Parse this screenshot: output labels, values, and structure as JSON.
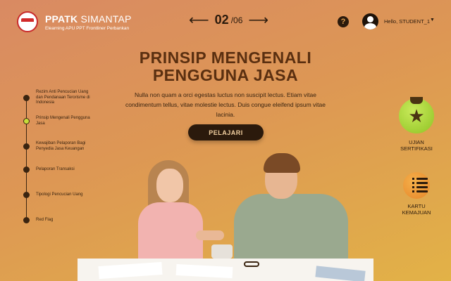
{
  "header": {
    "brand_bold": "PPATK",
    "brand_light": "SIMANTAP",
    "brand_sub": "Elearning APU PPT Frontliner Perbankan",
    "pager": {
      "prev_icon": "arrow-left",
      "current": "02",
      "total": "/06",
      "next_icon": "arrow-right"
    },
    "help_label": "?",
    "greeting": "Hello, STUDENT_1",
    "caret": "▼"
  },
  "hero": {
    "title_line1": "PRINSIP MENGENALI",
    "title_line2": "PENGGUNA JASA",
    "description": "Nulla non quam a orci egestas luctus non suscipit lectus. Etiam vitae condimentum tellus, vitae molestie lectus. Duis congue eleifend ipsum vitae lacinia.",
    "cta_label": "PELAJARI"
  },
  "timeline": {
    "items": [
      {
        "label": "Rezim Anti Pencucian Uang dan Pendanaan Terorisme di Indonesia",
        "active": false
      },
      {
        "label": "Prinsip Mengenali Pengguna Jasa",
        "active": true
      },
      {
        "label": "Kewajiban Pelaporan Bagi Penyedia Jasa Keuangan",
        "active": false
      },
      {
        "label": "Pelaporan Transaksi",
        "active": false
      },
      {
        "label": "Tipologi Pencucian Uang",
        "active": false
      },
      {
        "label": "Red Flag",
        "active": false
      }
    ]
  },
  "badges": {
    "ujian": {
      "line1": "UJIAN",
      "line2": "SERTIFIKASI",
      "icon": "star-medal-icon"
    },
    "kartu": {
      "line1": "KARTU",
      "line2": "KEMAJUAN",
      "icon": "checklist-icon"
    }
  },
  "colors": {
    "accent_dark": "#2b1a0c",
    "active_dot": "#c6dd3a",
    "title": "#5a2f10"
  }
}
